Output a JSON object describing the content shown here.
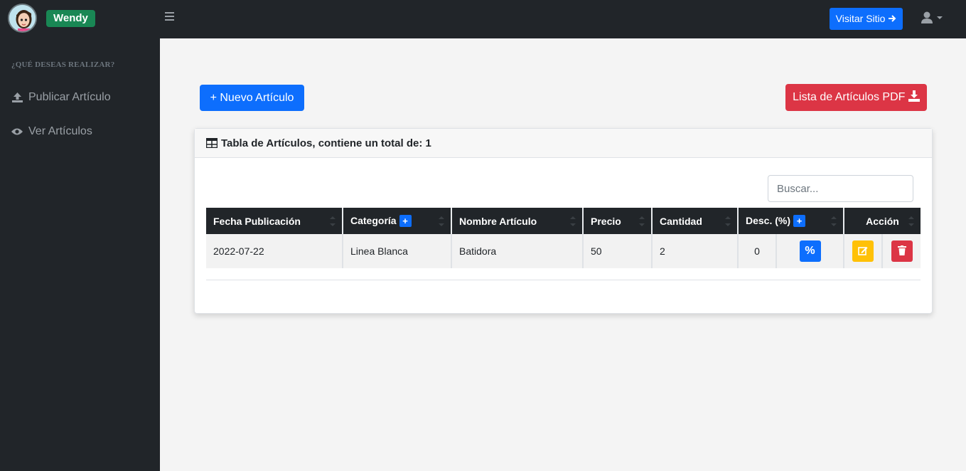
{
  "app": {
    "user_name": "Wendy",
    "visit_site_label": "Visitar Sitio"
  },
  "sidebar": {
    "heading": "¿QUÉ DESEAS REALIZAR?",
    "items": [
      {
        "label": "Publicar Artículo",
        "icon": "upload-icon"
      },
      {
        "label": "Ver Artículos",
        "icon": "eye-icon"
      }
    ]
  },
  "actions": {
    "new_label": "+ Nuevo Artículo",
    "pdf_label": "Lista de Artículos PDF"
  },
  "card": {
    "title": "Tabla de Artículos, contiene un total de: 1",
    "search_placeholder": "Buscar..."
  },
  "table": {
    "headers": [
      "Fecha Publicación",
      "Categoría",
      "Nombre Artículo",
      "Precio",
      "Cantidad",
      "Desc. (%)",
      "Acción"
    ],
    "rows": [
      {
        "fecha": "2022-07-22",
        "categoria": "Linea Blanca",
        "nombre": "Batidora",
        "precio": "50",
        "cantidad": "2",
        "descuento": "0"
      }
    ]
  },
  "colors": {
    "primary": "#0d6efd",
    "danger": "#dc3545",
    "warning": "#ffc107",
    "success": "#198754",
    "dark": "#212529"
  }
}
